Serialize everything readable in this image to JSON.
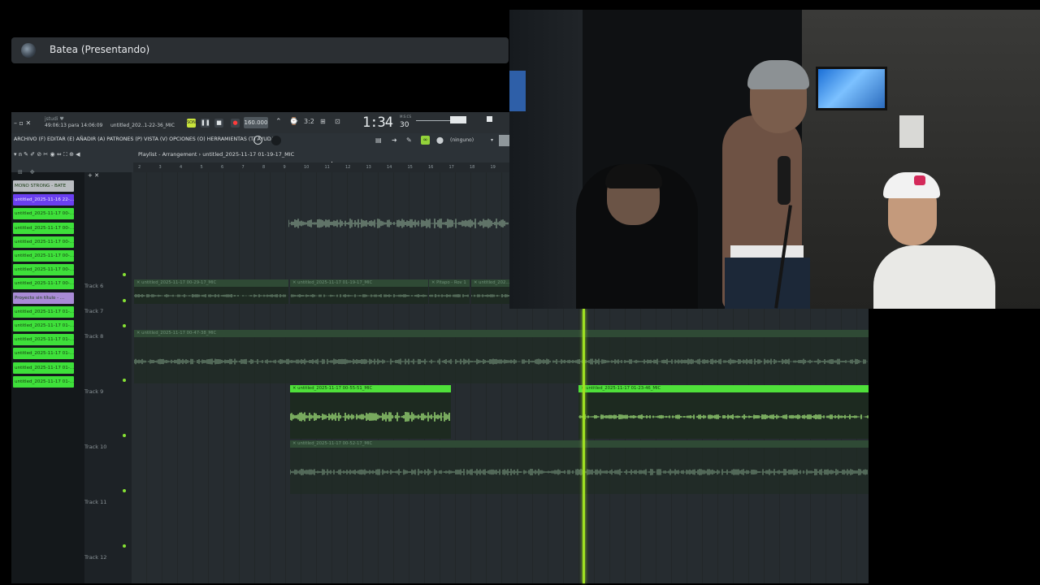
{
  "presenter": {
    "name": "Batea (Presentando)"
  },
  "fl": {
    "song_info": "49:06:13 para 14:06:09",
    "project_file": "untitled_202..1-22-36_MIC",
    "tempo": "160.000",
    "time": "1:34",
    "time_small": "30",
    "time_unit": "M:S:CS",
    "menu": "ARCHIVO (F) EDITAR (E) AÑADIR (A) PATRONES (P) VISTA (V) OPCIONES (O) HERRAMIENTAS (T) AYUDA",
    "snap": "(ninguno)",
    "playlist_title": "Playlist - Arrangement › untitled_2025-11-17 01-19-17_MIC",
    "ruler_numbers": [
      "2",
      "3",
      "4",
      "5",
      "6",
      "7",
      "8",
      "9",
      "10",
      "11",
      "12",
      "13",
      "14",
      "15",
      "16",
      "17",
      "18",
      "19"
    ]
  },
  "clip_list": [
    {
      "label": "MONO STRONG - BATE",
      "color": "#b9bcc0"
    },
    {
      "label": "untitled_2025-11-16 22-...",
      "color": "#6a3ff0"
    },
    {
      "label": "untitled_2025-11-17 00-...",
      "color": "#3ee03a"
    },
    {
      "label": "untitled_2025-11-17 00-...",
      "color": "#3ee03a"
    },
    {
      "label": "untitled_2025-11-17 00-...",
      "color": "#3ee03a"
    },
    {
      "label": "untitled_2025-11-17 00-...",
      "color": "#3ee03a"
    },
    {
      "label": "untitled_2025-11-17 00-...",
      "color": "#3ee03a"
    },
    {
      "label": "untitled_2025-11-17 00-...",
      "color": "#3ee03a"
    },
    {
      "label": "Proyecto sin título - ...",
      "color": "#a98bd6"
    },
    {
      "label": "untitled_2025-11-17 01-...",
      "color": "#3ee03a"
    },
    {
      "label": "untitled_2025-11-17 01-...",
      "color": "#3ee03a"
    },
    {
      "label": "untitled_2025-11-17 01-...",
      "color": "#3ee03a"
    },
    {
      "label": "untitled_2025-11-17 01-...",
      "color": "#3ee03a"
    },
    {
      "label": "untitled_2025-11-17 01-...",
      "color": "#3ee03a"
    },
    {
      "label": "untitled_2025-11-17 01-...",
      "color": "#3ee03a"
    }
  ],
  "tracks": [
    "Track 6",
    "Track 7",
    "Track 8",
    "Track 9",
    "Track 10",
    "Track 11",
    "Track 12"
  ],
  "clips": {
    "track6_a": "untitled_2025-11-17 00-29-17_MIC",
    "track6_b": "untitled_2025-11-17 01-19-17_MIC",
    "track6_c": "Pitapo - Rov 1",
    "track6_d": "untitled_202...",
    "track8": "untitled_2025-11-17 00-47-38_MIC",
    "track9_a": "untitled_2025-11-17 00-55-51_MIC",
    "track9_b": "untitled_2025-11-17 01-23-46_MIC",
    "track10": "untitled_2025-11-17 00-52-17_MIC"
  }
}
